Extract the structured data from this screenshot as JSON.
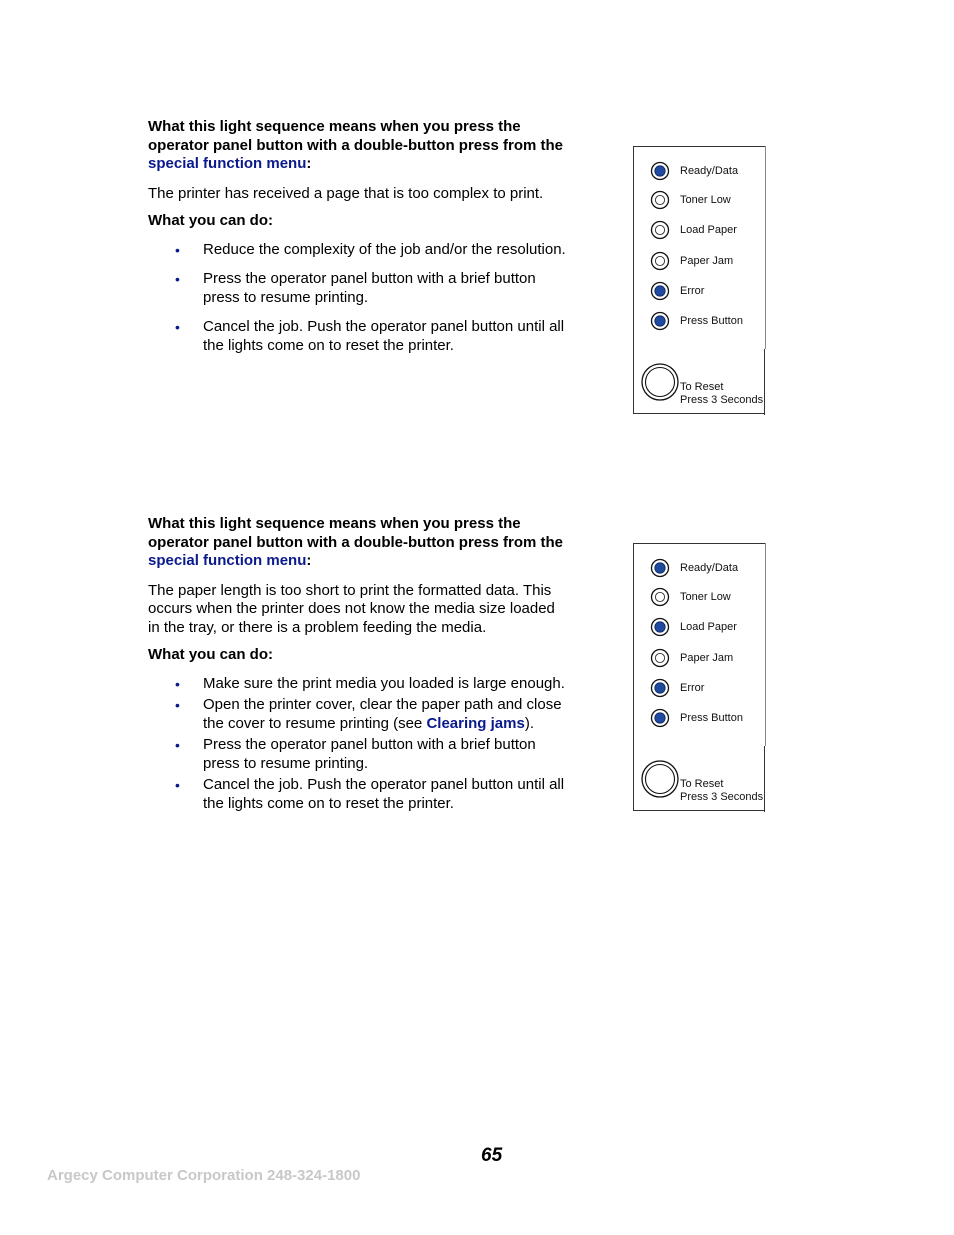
{
  "sections": [
    {
      "heading_prefix": "What this light sequence means when you press the operator panel button with a double-button press from the ",
      "heading_link": "special function menu",
      "heading_suffix": ":",
      "description": "The printer has received a page that is too complex to print.",
      "what_you_can_do": "What you can do:",
      "bullets": [
        "Reduce the complexity of the job and/or the resolution.",
        "Press the operator panel button with a brief button press to resume printing.",
        "Cancel the job. Push the operator panel button until all the lights come on to reset the printer."
      ],
      "panel": {
        "lights": [
          {
            "label": "Ready/Data",
            "on": true
          },
          {
            "label": "Toner Low",
            "on": false
          },
          {
            "label": "Load Paper",
            "on": false
          },
          {
            "label": "Paper Jam",
            "on": false
          },
          {
            "label": "Error",
            "on": true
          },
          {
            "label": "Press Button",
            "on": true
          }
        ],
        "reset_line1": "To Reset",
        "reset_line2": "Press 3 Seconds"
      }
    },
    {
      "heading_prefix": "What this light sequence means when you press the operator panel button with a double-button press from the ",
      "heading_link": "special function menu",
      "heading_suffix": ":",
      "description": "The paper length is too short to print the formatted data. This occurs when the printer does not know the media size loaded in the tray, or there is a problem feeding the media.",
      "what_you_can_do": "What you can do:",
      "bullets": [
        "Make sure the print media you loaded is large enough.",
        "Open the printer cover, clear the paper path and close the cover to resume printing (see ",
        "Press the operator panel button with a brief button press to resume printing.",
        "Cancel the job. Push the operator panel button until all the lights come on to reset the printer."
      ],
      "bullet2_link": "Clearing jams",
      "bullet2_suffix": ").",
      "panel": {
        "lights": [
          {
            "label": "Ready/Data",
            "on": true
          },
          {
            "label": "Toner Low",
            "on": false
          },
          {
            "label": "Load Paper",
            "on": true
          },
          {
            "label": "Paper Jam",
            "on": false
          },
          {
            "label": "Error",
            "on": true
          },
          {
            "label": "Press Button",
            "on": true
          }
        ],
        "reset_line1": "To Reset",
        "reset_line2": "Press 3 Seconds"
      }
    }
  ],
  "colors": {
    "link": "#0a1a8c",
    "light_on": "#1f4aa0",
    "footer": "#c8c8c8"
  },
  "page_number": "65",
  "footer_text": "Argecy Computer Corporation 248-324-1800"
}
